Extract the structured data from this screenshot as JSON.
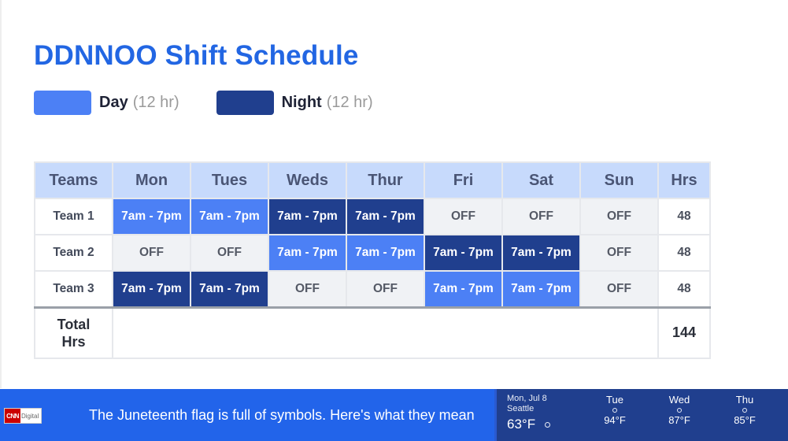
{
  "title": "DDNNOO Shift Schedule",
  "colors": {
    "title": "#2266e3",
    "day_shift": "#4c80f5",
    "night_shift": "#203f8e",
    "off": "#f0f2f5",
    "header_bg": "#c7dafc",
    "ticker_bg": "#2264ea",
    "weather_bg": "#203f8e"
  },
  "legend": [
    {
      "type": "day",
      "label": "Day",
      "sub": "(12 hr)"
    },
    {
      "type": "night",
      "label": "Night",
      "sub": "(12 hr)"
    }
  ],
  "table": {
    "headers": [
      "Teams",
      "Mon",
      "Tues",
      "Weds",
      "Thur",
      "Fri",
      "Sat",
      "Sun",
      "Hrs"
    ],
    "rows": [
      {
        "team": "Team 1",
        "cells": [
          {
            "text": "7am - 7pm",
            "type": "day"
          },
          {
            "text": "7am - 7pm",
            "type": "day"
          },
          {
            "text": "7am - 7pm",
            "type": "night"
          },
          {
            "text": "7am - 7pm",
            "type": "night"
          },
          {
            "text": "OFF",
            "type": "off"
          },
          {
            "text": "OFF",
            "type": "off"
          },
          {
            "text": "OFF",
            "type": "off"
          }
        ],
        "hrs": "48"
      },
      {
        "team": "Team 2",
        "cells": [
          {
            "text": "OFF",
            "type": "off"
          },
          {
            "text": "OFF",
            "type": "off"
          },
          {
            "text": "7am - 7pm",
            "type": "day"
          },
          {
            "text": "7am - 7pm",
            "type": "day"
          },
          {
            "text": "7am - 7pm",
            "type": "night"
          },
          {
            "text": "7am - 7pm",
            "type": "night"
          },
          {
            "text": "OFF",
            "type": "off"
          }
        ],
        "hrs": "48"
      },
      {
        "team": "Team 3",
        "cells": [
          {
            "text": "7am - 7pm",
            "type": "night"
          },
          {
            "text": "7am - 7pm",
            "type": "night"
          },
          {
            "text": "OFF",
            "type": "off"
          },
          {
            "text": "OFF",
            "type": "off"
          },
          {
            "text": "7am - 7pm",
            "type": "day"
          },
          {
            "text": "7am - 7pm",
            "type": "day"
          },
          {
            "text": "OFF",
            "type": "off"
          }
        ],
        "hrs": "48"
      }
    ],
    "total": {
      "label_line1": "Total",
      "label_line2": "Hrs",
      "hrs": "144"
    }
  },
  "ticker": {
    "logo_cnn": "CNN",
    "logo_digital": "Digital",
    "headline": "The Juneteenth flag is full of symbols. Here's what they mean"
  },
  "weather": {
    "today": {
      "date": "Mon, Jul 8",
      "city": "Seattle",
      "temp": "63°F",
      "icon": "sun-icon"
    },
    "forecast": [
      {
        "day": "Tue",
        "temp": "94°F",
        "icon": "sun-icon"
      },
      {
        "day": "Wed",
        "temp": "87°F",
        "icon": "sun-icon"
      },
      {
        "day": "Thu",
        "temp": "85°F",
        "icon": "sun-icon"
      }
    ]
  }
}
